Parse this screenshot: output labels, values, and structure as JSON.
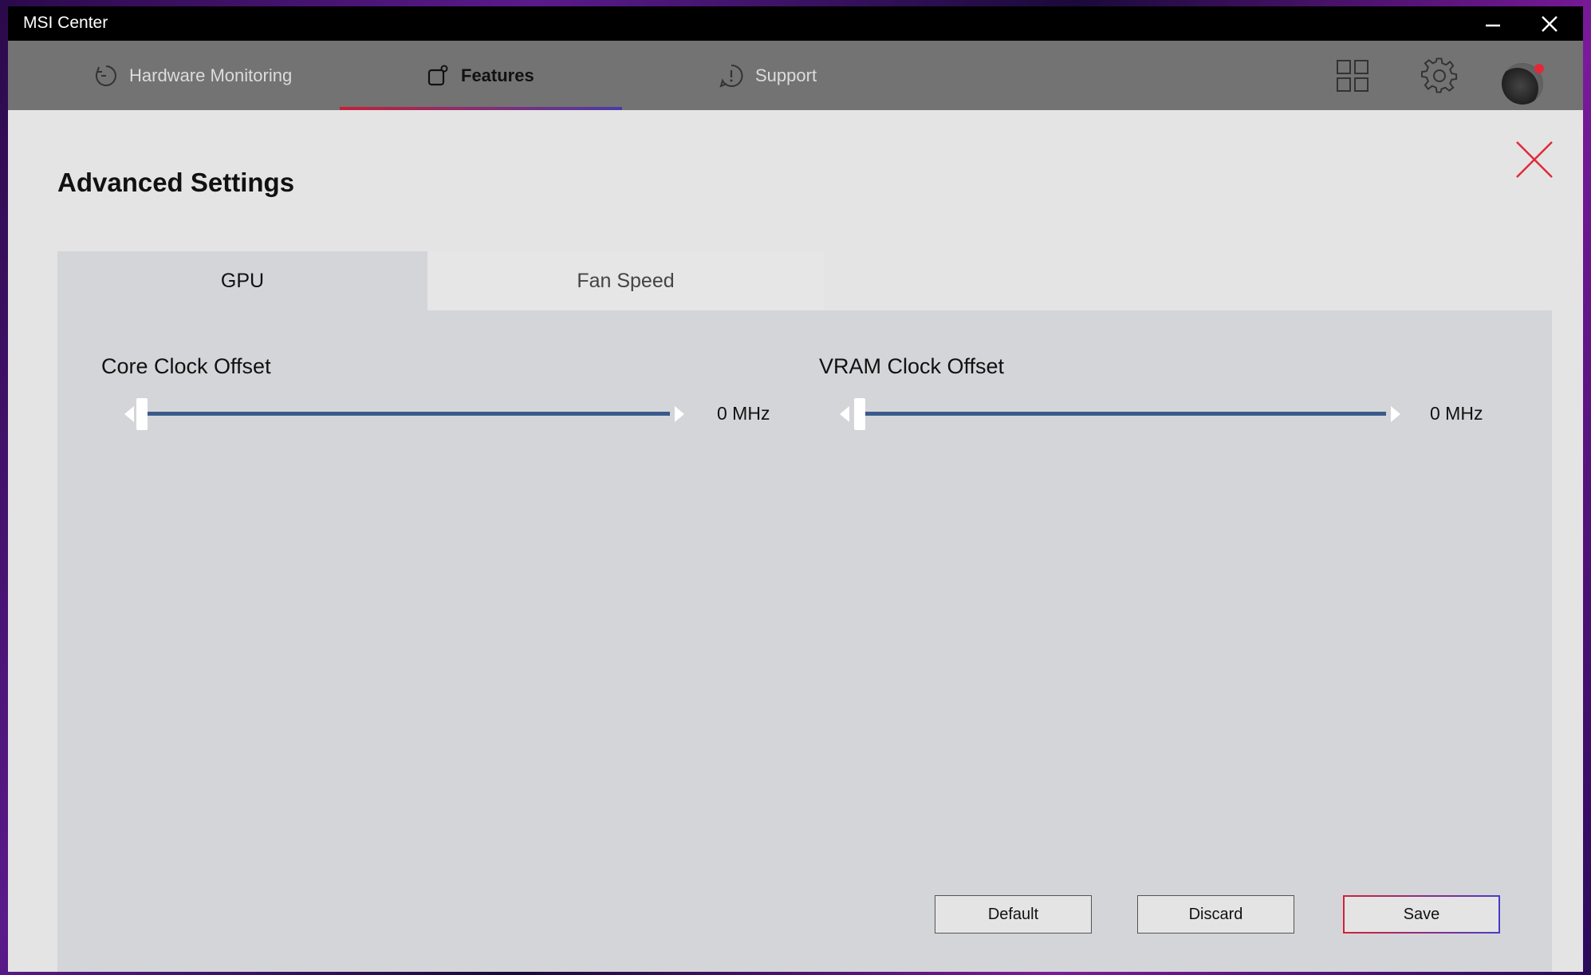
{
  "window": {
    "title": "MSI Center"
  },
  "nav": {
    "tabs": [
      {
        "label": "Hardware Monitoring",
        "icon": "clock-icon"
      },
      {
        "label": "Features",
        "icon": "features-icon",
        "active": true
      },
      {
        "label": "Support",
        "icon": "support-icon"
      }
    ],
    "icons": [
      "grid-icon",
      "gear-icon",
      "avatar"
    ]
  },
  "panel": {
    "title": "Advanced Settings",
    "tabs": [
      {
        "label": "GPU",
        "active": true
      },
      {
        "label": "Fan Speed",
        "active": false
      }
    ],
    "sliders": [
      {
        "label": "Core Clock Offset",
        "value": "0 MHz",
        "level": 0
      },
      {
        "label": "VRAM Clock Offset",
        "value": "0 MHz",
        "level": 0
      }
    ],
    "buttons": {
      "default": "Default",
      "discard": "Discard",
      "save": "Save"
    }
  },
  "colors": {
    "accent_red": "#e02a3a",
    "accent_blue": "#4a3ac8",
    "slider_track": "#3a5a8a"
  }
}
